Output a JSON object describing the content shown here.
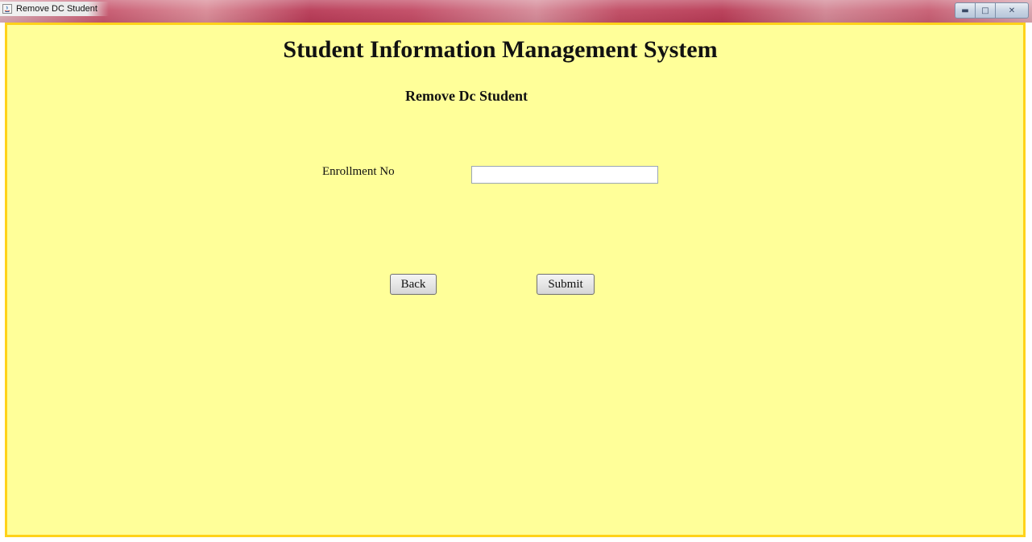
{
  "window": {
    "title": "Remove DC Student",
    "controls": {
      "minimize_icon": "minimize-icon",
      "maximize_icon": "maximize-icon",
      "close_icon": "close-icon"
    }
  },
  "colors": {
    "panel_background": "#ffff99",
    "panel_border": "#ffd21a",
    "titlebar_accent": "#c24a64"
  },
  "main": {
    "title": "Student Information Management System",
    "subtitle": "Remove Dc Student",
    "form": {
      "enrollment_label": "Enrollment No",
      "enrollment_value": "",
      "enrollment_placeholder": ""
    },
    "buttons": {
      "back_label": "Back",
      "submit_label": "Submit"
    }
  }
}
